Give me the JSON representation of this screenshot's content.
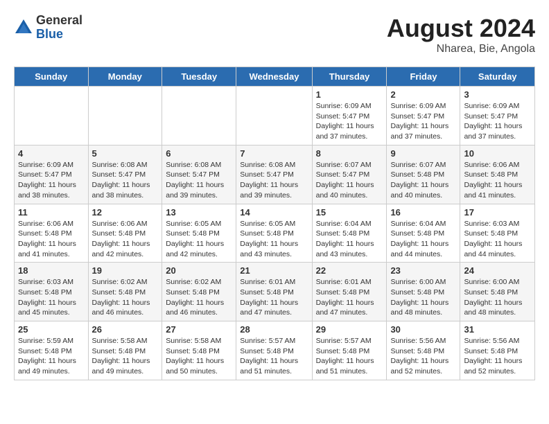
{
  "header": {
    "logo_general": "General",
    "logo_blue": "Blue",
    "title": "August 2024",
    "location": "Nharea, Bie, Angola"
  },
  "weekdays": [
    "Sunday",
    "Monday",
    "Tuesday",
    "Wednesday",
    "Thursday",
    "Friday",
    "Saturday"
  ],
  "weeks": [
    [
      {
        "day": "",
        "info": ""
      },
      {
        "day": "",
        "info": ""
      },
      {
        "day": "",
        "info": ""
      },
      {
        "day": "",
        "info": ""
      },
      {
        "day": "1",
        "info": "Sunrise: 6:09 AM\nSunset: 5:47 PM\nDaylight: 11 hours and 37 minutes."
      },
      {
        "day": "2",
        "info": "Sunrise: 6:09 AM\nSunset: 5:47 PM\nDaylight: 11 hours and 37 minutes."
      },
      {
        "day": "3",
        "info": "Sunrise: 6:09 AM\nSunset: 5:47 PM\nDaylight: 11 hours and 37 minutes."
      }
    ],
    [
      {
        "day": "4",
        "info": "Sunrise: 6:09 AM\nSunset: 5:47 PM\nDaylight: 11 hours and 38 minutes."
      },
      {
        "day": "5",
        "info": "Sunrise: 6:08 AM\nSunset: 5:47 PM\nDaylight: 11 hours and 38 minutes."
      },
      {
        "day": "6",
        "info": "Sunrise: 6:08 AM\nSunset: 5:47 PM\nDaylight: 11 hours and 39 minutes."
      },
      {
        "day": "7",
        "info": "Sunrise: 6:08 AM\nSunset: 5:47 PM\nDaylight: 11 hours and 39 minutes."
      },
      {
        "day": "8",
        "info": "Sunrise: 6:07 AM\nSunset: 5:47 PM\nDaylight: 11 hours and 40 minutes."
      },
      {
        "day": "9",
        "info": "Sunrise: 6:07 AM\nSunset: 5:48 PM\nDaylight: 11 hours and 40 minutes."
      },
      {
        "day": "10",
        "info": "Sunrise: 6:06 AM\nSunset: 5:48 PM\nDaylight: 11 hours and 41 minutes."
      }
    ],
    [
      {
        "day": "11",
        "info": "Sunrise: 6:06 AM\nSunset: 5:48 PM\nDaylight: 11 hours and 41 minutes."
      },
      {
        "day": "12",
        "info": "Sunrise: 6:06 AM\nSunset: 5:48 PM\nDaylight: 11 hours and 42 minutes."
      },
      {
        "day": "13",
        "info": "Sunrise: 6:05 AM\nSunset: 5:48 PM\nDaylight: 11 hours and 42 minutes."
      },
      {
        "day": "14",
        "info": "Sunrise: 6:05 AM\nSunset: 5:48 PM\nDaylight: 11 hours and 43 minutes."
      },
      {
        "day": "15",
        "info": "Sunrise: 6:04 AM\nSunset: 5:48 PM\nDaylight: 11 hours and 43 minutes."
      },
      {
        "day": "16",
        "info": "Sunrise: 6:04 AM\nSunset: 5:48 PM\nDaylight: 11 hours and 44 minutes."
      },
      {
        "day": "17",
        "info": "Sunrise: 6:03 AM\nSunset: 5:48 PM\nDaylight: 11 hours and 44 minutes."
      }
    ],
    [
      {
        "day": "18",
        "info": "Sunrise: 6:03 AM\nSunset: 5:48 PM\nDaylight: 11 hours and 45 minutes."
      },
      {
        "day": "19",
        "info": "Sunrise: 6:02 AM\nSunset: 5:48 PM\nDaylight: 11 hours and 46 minutes."
      },
      {
        "day": "20",
        "info": "Sunrise: 6:02 AM\nSunset: 5:48 PM\nDaylight: 11 hours and 46 minutes."
      },
      {
        "day": "21",
        "info": "Sunrise: 6:01 AM\nSunset: 5:48 PM\nDaylight: 11 hours and 47 minutes."
      },
      {
        "day": "22",
        "info": "Sunrise: 6:01 AM\nSunset: 5:48 PM\nDaylight: 11 hours and 47 minutes."
      },
      {
        "day": "23",
        "info": "Sunrise: 6:00 AM\nSunset: 5:48 PM\nDaylight: 11 hours and 48 minutes."
      },
      {
        "day": "24",
        "info": "Sunrise: 6:00 AM\nSunset: 5:48 PM\nDaylight: 11 hours and 48 minutes."
      }
    ],
    [
      {
        "day": "25",
        "info": "Sunrise: 5:59 AM\nSunset: 5:48 PM\nDaylight: 11 hours and 49 minutes."
      },
      {
        "day": "26",
        "info": "Sunrise: 5:58 AM\nSunset: 5:48 PM\nDaylight: 11 hours and 49 minutes."
      },
      {
        "day": "27",
        "info": "Sunrise: 5:58 AM\nSunset: 5:48 PM\nDaylight: 11 hours and 50 minutes."
      },
      {
        "day": "28",
        "info": "Sunrise: 5:57 AM\nSunset: 5:48 PM\nDaylight: 11 hours and 51 minutes."
      },
      {
        "day": "29",
        "info": "Sunrise: 5:57 AM\nSunset: 5:48 PM\nDaylight: 11 hours and 51 minutes."
      },
      {
        "day": "30",
        "info": "Sunrise: 5:56 AM\nSunset: 5:48 PM\nDaylight: 11 hours and 52 minutes."
      },
      {
        "day": "31",
        "info": "Sunrise: 5:56 AM\nSunset: 5:48 PM\nDaylight: 11 hours and 52 minutes."
      }
    ]
  ]
}
